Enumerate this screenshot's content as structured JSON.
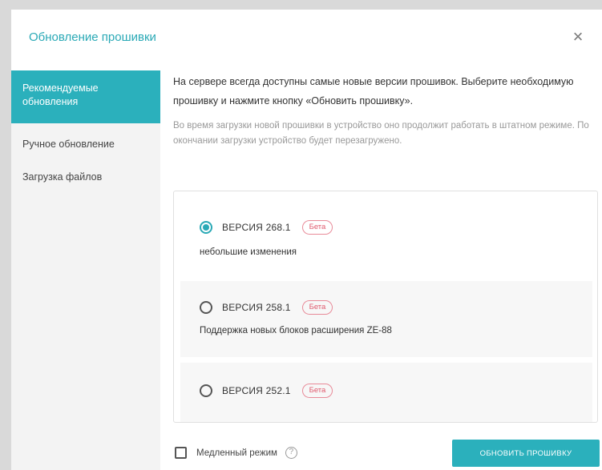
{
  "dialog": {
    "title": "Обновление прошивки",
    "close_symbol": "×"
  },
  "sidebar": {
    "items": [
      {
        "label": "Рекомендуемые обновления",
        "active": true
      },
      {
        "label": "Ручное обновление",
        "active": false
      },
      {
        "label": "Загрузка файлов",
        "active": false
      }
    ]
  },
  "content": {
    "intro": "На сервере всегда доступны самые новые версии прошивок. Выберите необходимую прошивку и нажмите кнопку «Обновить прошивку».",
    "note": "Во время загрузки новой прошивки в устройство оно продолжит работать в штатном режиме. По окончании загрузки устройство будет перезагружено."
  },
  "versions": [
    {
      "name": "ВЕРСИЯ 268.1",
      "badge": "Бета",
      "description": "небольшие изменения",
      "selected": true
    },
    {
      "name": "ВЕРСИЯ 258.1",
      "badge": "Бета",
      "description": "Поддержка новых блоков расширения ZE-88",
      "selected": false
    },
    {
      "name": "ВЕРСИЯ 252.1",
      "badge": "Бета",
      "description": "",
      "selected": false
    }
  ],
  "footer": {
    "slow_mode_label": "Медленный режим",
    "slow_mode_checked": false,
    "help_symbol": "?",
    "update_button": "ОБНОВИТЬ ПРОШИВКУ"
  },
  "colors": {
    "accent": "#2bb0bc",
    "badge": "#e05a6e"
  }
}
